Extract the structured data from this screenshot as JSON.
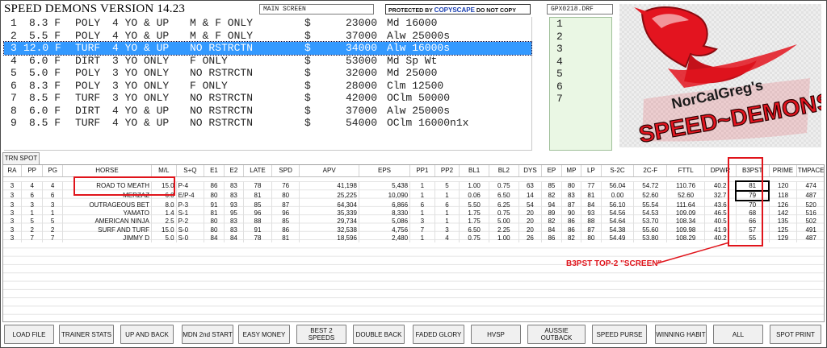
{
  "header": {
    "app_title": "SPEED DEMONS VERSION 14.23",
    "screen_label": "MAIN SCREEN",
    "protected_prefix": "PROTECTED BY",
    "protected_brand": "COPYSCAPE",
    "protected_suffix": "DO NOT COPY",
    "file_name": "GPX0218.DRF"
  },
  "races": [
    {
      "num": "1",
      "dist": "8.3 F",
      "surface": "POLY",
      "age": "4 YO & UP",
      "cond": "M & F ONLY",
      "dollar": "$",
      "purse": "23000",
      "class": "Md 16000"
    },
    {
      "num": "2",
      "dist": "5.5 F",
      "surface": "POLY",
      "age": "4 YO & UP",
      "cond": "M & F ONLY",
      "dollar": "$",
      "purse": "37000",
      "class": "Alw 25000s"
    },
    {
      "num": "3",
      "dist": "12.0 F",
      "surface": "TURF",
      "age": "4 YO & UP",
      "cond": "NO RSTRCTN",
      "dollar": "$",
      "purse": "34000",
      "class": "Alw 16000s"
    },
    {
      "num": "4",
      "dist": "6.0 F",
      "surface": "DIRT",
      "age": "3 YO ONLY",
      "cond": "F ONLY",
      "dollar": "$",
      "purse": "53000",
      "class": "Md Sp Wt"
    },
    {
      "num": "5",
      "dist": "5.0 F",
      "surface": "POLY",
      "age": "3 YO ONLY",
      "cond": "NO RSTRCTN",
      "dollar": "$",
      "purse": "32000",
      "class": "Md 25000"
    },
    {
      "num": "6",
      "dist": "8.3 F",
      "surface": "POLY",
      "age": "3 YO ONLY",
      "cond": "F ONLY",
      "dollar": "$",
      "purse": "28000",
      "class": "Clm 12500"
    },
    {
      "num": "7",
      "dist": "8.5 F",
      "surface": "TURF",
      "age": "3 YO ONLY",
      "cond": "NO RSTRCTN",
      "dollar": "$",
      "purse": "42000",
      "class": "OClm 50000"
    },
    {
      "num": "8",
      "dist": "6.0 F",
      "surface": "DIRT",
      "age": "4 YO & UP",
      "cond": "NO RSTRCTN",
      "dollar": "$",
      "purse": "37000",
      "class": "Alw 25000s"
    },
    {
      "num": "9",
      "dist": "8.5 F",
      "surface": "TURF",
      "age": "4 YO & UP",
      "cond": "NO RSTRCTN",
      "dollar": "$",
      "purse": "54000",
      "class": "OClm 16000n1x"
    }
  ],
  "selected_race_index": 2,
  "horse_numbers": [
    "1",
    "2",
    "3",
    "4",
    "5",
    "6",
    "7"
  ],
  "logo": {
    "line1": "NorCalGreg's",
    "line2": "SPEED~DEMONS",
    "colors": {
      "red": "#e3141f",
      "dark": "#1a1a1a",
      "white": "#ffffff"
    }
  },
  "tab_label": "TRN SPOT",
  "columns": [
    "RA",
    "PP",
    "PG",
    "HORSE",
    "M/L",
    "S+Q",
    "E1",
    "E2",
    "LATE",
    "SPD",
    "APV",
    "EPS",
    "PP1",
    "PP2",
    "BL1",
    "BL2",
    "DYS",
    "EP",
    "MP",
    "LP",
    "S-2C",
    "2C-F",
    "FTTL",
    "DPWR",
    "B3PST",
    "PRIME",
    "TMPACE"
  ],
  "rows": [
    [
      "3",
      "4",
      "4",
      "ROAD TO MEATH",
      "15.0",
      "P-4",
      "86",
      "83",
      "78",
      "76",
      "41,198",
      "5,438",
      "1",
      "5",
      "1.00",
      "0.75",
      "63",
      "85",
      "80",
      "77",
      "56.04",
      "54.72",
      "110.76",
      "40.2",
      "81",
      "120",
      "474"
    ],
    [
      "3",
      "6",
      "6",
      "MERZAZ",
      "6.0",
      "E/P-4",
      "80",
      "83",
      "81",
      "80",
      "25,225",
      "10,090",
      "1",
      "1",
      "0.06",
      "6.50",
      "14",
      "82",
      "83",
      "81",
      "0.00",
      "52.60",
      "52.60",
      "32.7",
      "79",
      "118",
      "487"
    ],
    [
      "3",
      "3",
      "3",
      "OUTRAGEOUS BET",
      "8.0",
      "P-3",
      "91",
      "93",
      "85",
      "87",
      "64,304",
      "6,866",
      "6",
      "6",
      "5.50",
      "6.25",
      "54",
      "94",
      "87",
      "84",
      "56.10",
      "55.54",
      "111.64",
      "43.6",
      "70",
      "126",
      "520"
    ],
    [
      "3",
      "1",
      "1",
      "YAMATO",
      "1.4",
      "S-1",
      "81",
      "95",
      "96",
      "96",
      "35,339",
      "8,330",
      "1",
      "1",
      "1.75",
      "0.75",
      "20",
      "89",
      "90",
      "93",
      "54.56",
      "54.53",
      "109.09",
      "46.5",
      "68",
      "142",
      "516"
    ],
    [
      "3",
      "5",
      "5",
      "AMERICAN NINJA",
      "2.5",
      "P-2",
      "80",
      "83",
      "88",
      "85",
      "29,734",
      "5,086",
      "3",
      "1",
      "1.75",
      "5.00",
      "20",
      "82",
      "86",
      "88",
      "54.64",
      "53.70",
      "108.34",
      "40.5",
      "66",
      "135",
      "502"
    ],
    [
      "3",
      "2",
      "2",
      "SURF AND TURF",
      "15.0",
      "S-0",
      "80",
      "83",
      "91",
      "86",
      "32,538",
      "4,756",
      "7",
      "3",
      "6.50",
      "2.25",
      "20",
      "84",
      "86",
      "87",
      "54.38",
      "55.60",
      "109.98",
      "41.9",
      "57",
      "125",
      "491"
    ],
    [
      "3",
      "7",
      "7",
      "JIMMY D",
      "5.0",
      "S-0",
      "84",
      "84",
      "78",
      "81",
      "18,596",
      "2,480",
      "1",
      "4",
      "0.75",
      "1.00",
      "26",
      "86",
      "82",
      "80",
      "54.49",
      "53.80",
      "108.29",
      "40.2",
      "55",
      "129",
      "487"
    ]
  ],
  "annotation": "B3PST TOP-2 \"SCREEN\"",
  "buttons": [
    "LOAD FILE",
    "TRAINER STATS",
    "UP AND BACK",
    "MDN 2nd START",
    "EASY MONEY",
    "BEST 2 SPEEDS",
    "DOUBLE BACK",
    "FADED GLORY",
    "HVSP",
    "AUSSIE OUTBACK",
    "SPEED PURSE",
    "WINNING HABIT",
    "ALL",
    "SPOT PRINT"
  ]
}
